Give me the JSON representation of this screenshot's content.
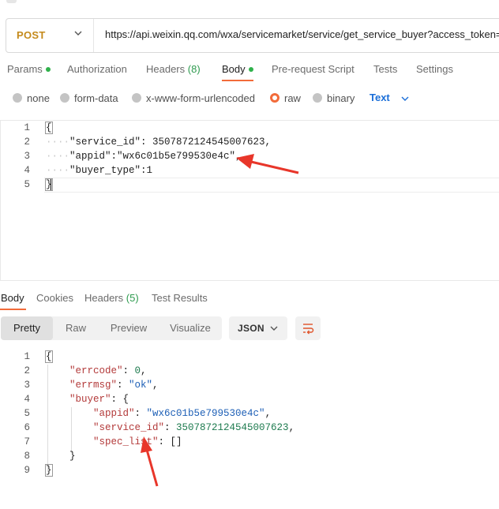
{
  "request": {
    "method": "POST",
    "url": "https://api.weixin.qq.com/wxa/servicemarket/service/get_service_buyer?access_token=",
    "tabs": [
      {
        "label": "Params",
        "dot": true
      },
      {
        "label": "Authorization"
      },
      {
        "label": "Headers",
        "count": "(8)"
      },
      {
        "label": "Body",
        "dot": true,
        "active": true
      },
      {
        "label": "Pre-request Script"
      },
      {
        "label": "Tests"
      },
      {
        "label": "Settings"
      }
    ],
    "body_types": [
      "none",
      "form-data",
      "x-www-form-urlencoded",
      "raw",
      "binary"
    ],
    "selected_body_type": "raw",
    "text_type": "Text",
    "line_numbers": [
      "1",
      "2",
      "3",
      "4",
      "5"
    ],
    "code_lines": [
      "{",
      "\"service_id\": 3507872124545007623,",
      "\"appid\":\"wx6c01b5e799530e4c\",",
      "\"buyer_type\":1",
      "}"
    ]
  },
  "response": {
    "tabs": [
      {
        "label": "Body",
        "active": true
      },
      {
        "label": "Cookies"
      },
      {
        "label": "Headers",
        "count": "(5)"
      },
      {
        "label": "Test Results"
      }
    ],
    "views": [
      "Pretty",
      "Raw",
      "Preview",
      "Visualize"
    ],
    "active_view": "Pretty",
    "format": "JSON",
    "line_numbers": [
      "1",
      "2",
      "3",
      "4",
      "5",
      "6",
      "7",
      "8",
      "9"
    ],
    "json": {
      "open": "{",
      "errcode_key": "\"errcode\"",
      "errcode_val": "0",
      "errmsg_key": "\"errmsg\"",
      "errmsg_val": "\"ok\"",
      "buyer_key": "\"buyer\"",
      "appid_key": "\"appid\"",
      "appid_val": "\"wx6c01b5e799530e4c\"",
      "service_id_key": "\"service_id\"",
      "service_id_val": "3507872124545007623",
      "spec_list_key": "\"spec_list\"",
      "spec_list_val": "[]",
      "inner_close": "}",
      "close": "}"
    }
  },
  "colors": {
    "accent": "#f26b3a",
    "method": "#c48a1b",
    "link_blue": "#1a6ed8",
    "annotation_arrow": "#e8362a"
  }
}
